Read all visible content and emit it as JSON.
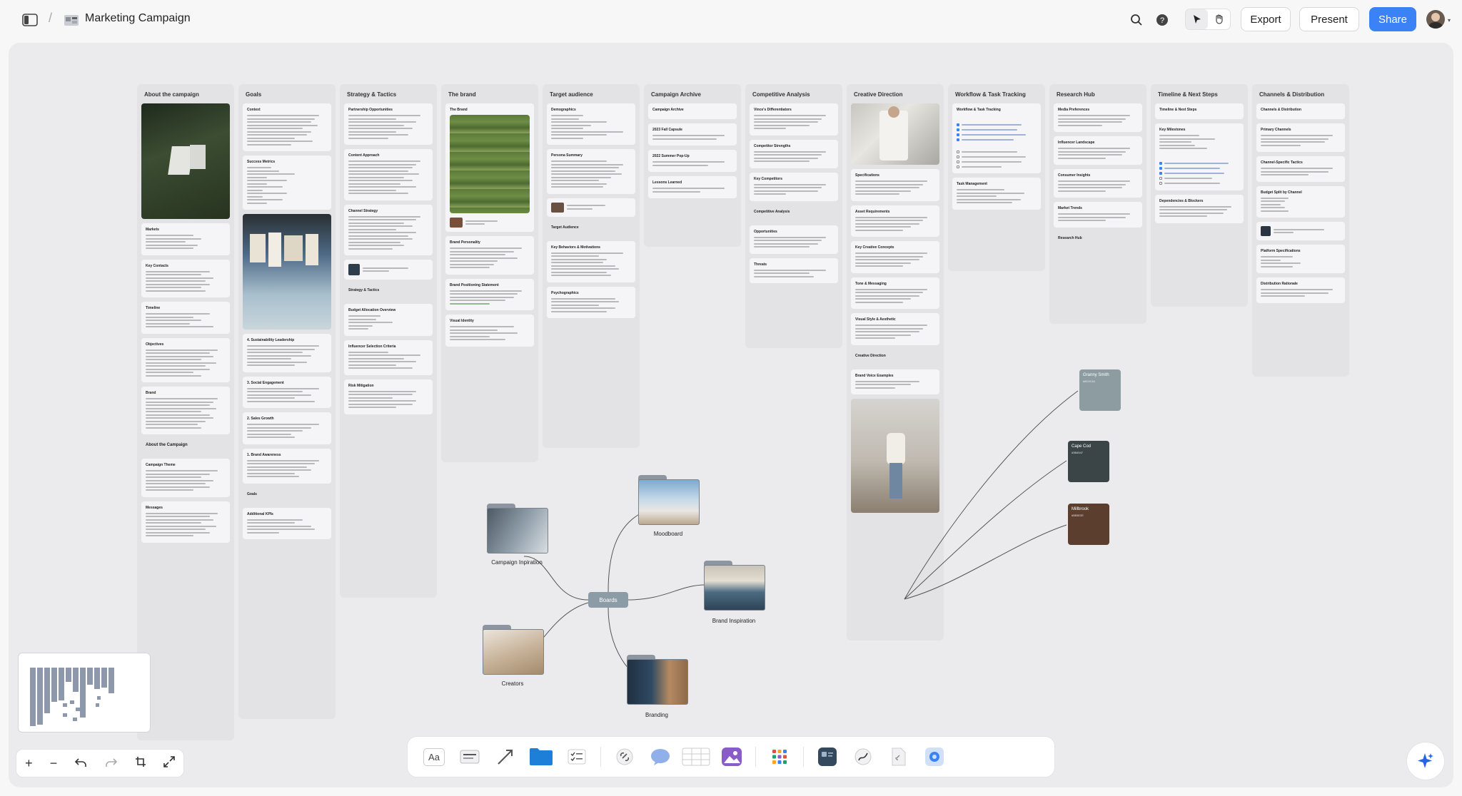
{
  "app": {
    "title": "Marketing Campaign"
  },
  "header": {
    "export_label": "Export",
    "present_label": "Present",
    "share_label": "Share"
  },
  "columns": [
    {
      "title": "About the campaign"
    },
    {
      "title": "Goals"
    },
    {
      "title": "Strategy & Tactics"
    },
    {
      "title": "The brand"
    },
    {
      "title": "Target audience"
    },
    {
      "title": "Campaign Archive"
    },
    {
      "title": "Competitive Analysis"
    },
    {
      "title": "Creative Direction"
    },
    {
      "title": "Workflow & Task Tracking"
    },
    {
      "title": "Research Hub"
    },
    {
      "title": "Timeline & Next Steps"
    },
    {
      "title": "Channels & Distribution"
    }
  ],
  "cards": {
    "c1": [
      "Markets",
      "Key Contacts",
      "Timeline",
      "Objectives",
      "Brand",
      "About the Campaign",
      "Campaign Theme",
      "Messages"
    ],
    "c2": [
      "Context",
      "Success Metrics",
      "4. Sustainability Leadership",
      "3. Social Engagement",
      "2. Sales Growth",
      "1. Brand Awareness",
      "Goals",
      "Additional KPIs"
    ],
    "c3": [
      "Partnership Opportunities",
      "Content Approach",
      "Channel Strategy",
      "Strategy & Tactics",
      "Budget Allocation Overview",
      "Influencer Selection Criteria",
      "Risk Mitigation"
    ],
    "c4": [
      "The Brand",
      "Brand Personality",
      "Brand Positioning Statement",
      "Visual Identity"
    ],
    "c5": [
      "Demographics",
      "Persona Summary",
      "Target Audience",
      "Key Behaviors & Motivations",
      "Psychographics"
    ],
    "c6": [
      "Campaign Archive",
      "2023 Fall Capsule",
      "2022 Summer Pop-Up",
      "Lessons Learned"
    ],
    "c7": [
      "Vince's Differentiators",
      "Competitor Strengths",
      "Key Competitors",
      "Competitive Analysis",
      "Opportunities",
      "Threats"
    ],
    "c8": [
      "Specifications",
      "Asset Requirements",
      "Key Creative Concepts",
      "Tone & Messaging",
      "Visual Style & Aesthetic",
      "Creative Direction",
      "Brand Voice Examples"
    ],
    "c9": [
      "Workflow & Task Tracking",
      "Task Management"
    ],
    "c10": [
      "Media Preferences",
      "Influencer Landscape",
      "Consumer Insights",
      "Market Trends",
      "Research Hub"
    ],
    "c11": [
      "Timeline & Next Steps",
      "Key Milestones",
      "Dependencies & Blockers"
    ],
    "c12": [
      "Channels & Distribution",
      "Primary Channels",
      "Channel-Specific Tactics",
      "Budget Split by Channel",
      "Platform Specifications",
      "Distribution Rationale"
    ]
  },
  "boards": {
    "center": "Boards",
    "folders": [
      "Campaign Inpiration",
      "Moodboard",
      "Brand Inspiration",
      "Creators",
      "Branding"
    ]
  },
  "swatches": [
    {
      "name": "Granny Smith",
      "hex": "#8C9CA1",
      "color": "#8c9ca1"
    },
    {
      "name": "Cape Cod",
      "hex": "#3B4547",
      "color": "#3b4547"
    },
    {
      "name": "Millbrook",
      "hex": "#5B3E2E",
      "color": "#5b3e2e"
    }
  ],
  "toolbar": {
    "text_tool": "Aa"
  },
  "zoom": {
    "plus": "+",
    "minus": "−"
  }
}
